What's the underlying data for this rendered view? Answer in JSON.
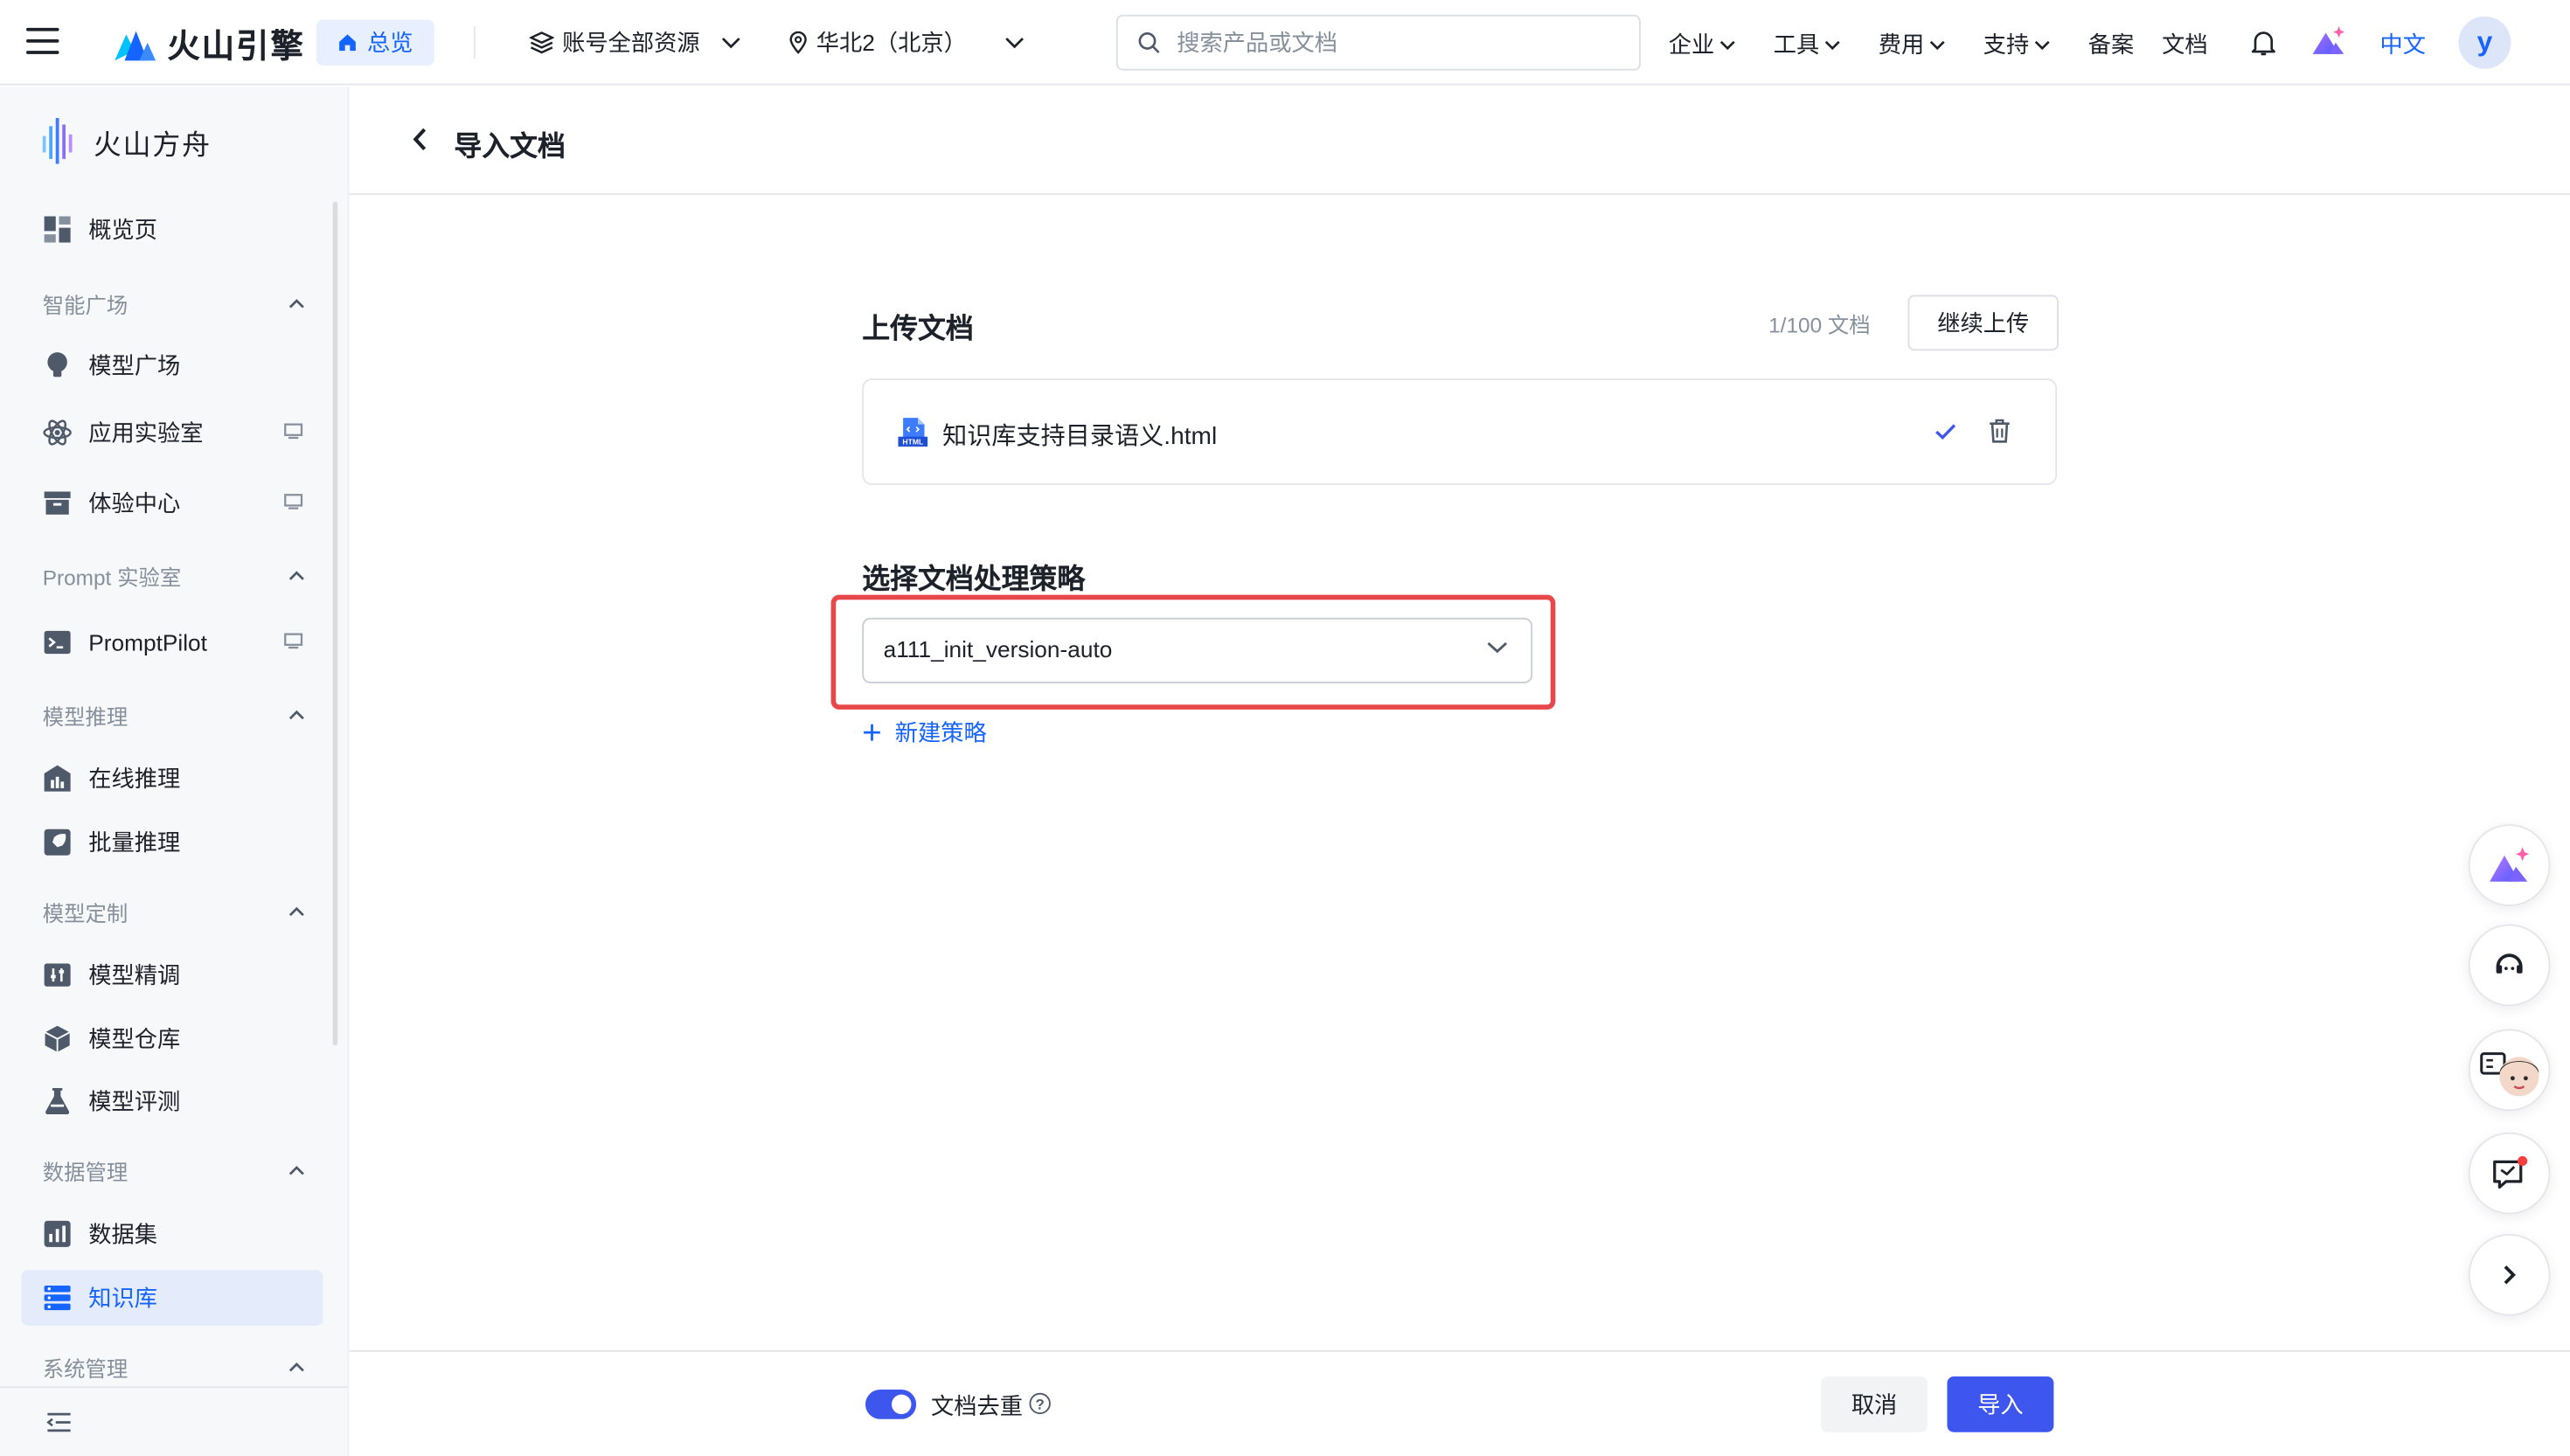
{
  "topbar": {
    "brand": "火山引擎",
    "overview_label": "总览",
    "resources_label": "账号全部资源",
    "region_label": "华北2（北京）",
    "search_placeholder": "搜索产品或文档",
    "nav": {
      "enterprise": "企业",
      "tools": "工具",
      "billing": "费用",
      "support": "支持",
      "filing": "备案",
      "docs": "文档",
      "language": "中文"
    },
    "avatar_letter": "y"
  },
  "sidebar": {
    "brand": "火山方舟",
    "overview": "概览页",
    "groups": {
      "smart_square": "智能广场",
      "prompt_lab": "Prompt 实验室",
      "inference": "模型推理",
      "customization": "模型定制",
      "data_mgmt": "数据管理",
      "system_mgmt": "系统管理"
    },
    "items": {
      "model_square": "模型广场",
      "app_lab": "应用实验室",
      "experience_center": "体验中心",
      "promptpilot": "PromptPilot",
      "online_inference": "在线推理",
      "batch_inference": "批量推理",
      "finetune": "模型精调",
      "model_repo": "模型仓库",
      "model_eval": "模型评测",
      "dataset": "数据集",
      "knowledge_base": "知识库"
    }
  },
  "page": {
    "title": "导入文档",
    "upload_title": "上传文档",
    "doc_count": "1/100 文档",
    "continue_upload": "继续上传",
    "file": {
      "name": "知识库支持目录语义.html",
      "icon_text": "HTML"
    },
    "strategy_title": "选择文档处理策略",
    "strategy_value": "a111_init_version-auto",
    "new_strategy": "新建策略"
  },
  "footer": {
    "dedup_label": "文档去重",
    "help": "?",
    "cancel": "取消",
    "import": "导入"
  },
  "colors": {
    "accent": "#1664ff",
    "primary_button": "#3d56ee",
    "highlight_border": "#e8484a",
    "sidebar_bg": "#f7f8fa",
    "active_item_bg": "#e4ecfb"
  }
}
